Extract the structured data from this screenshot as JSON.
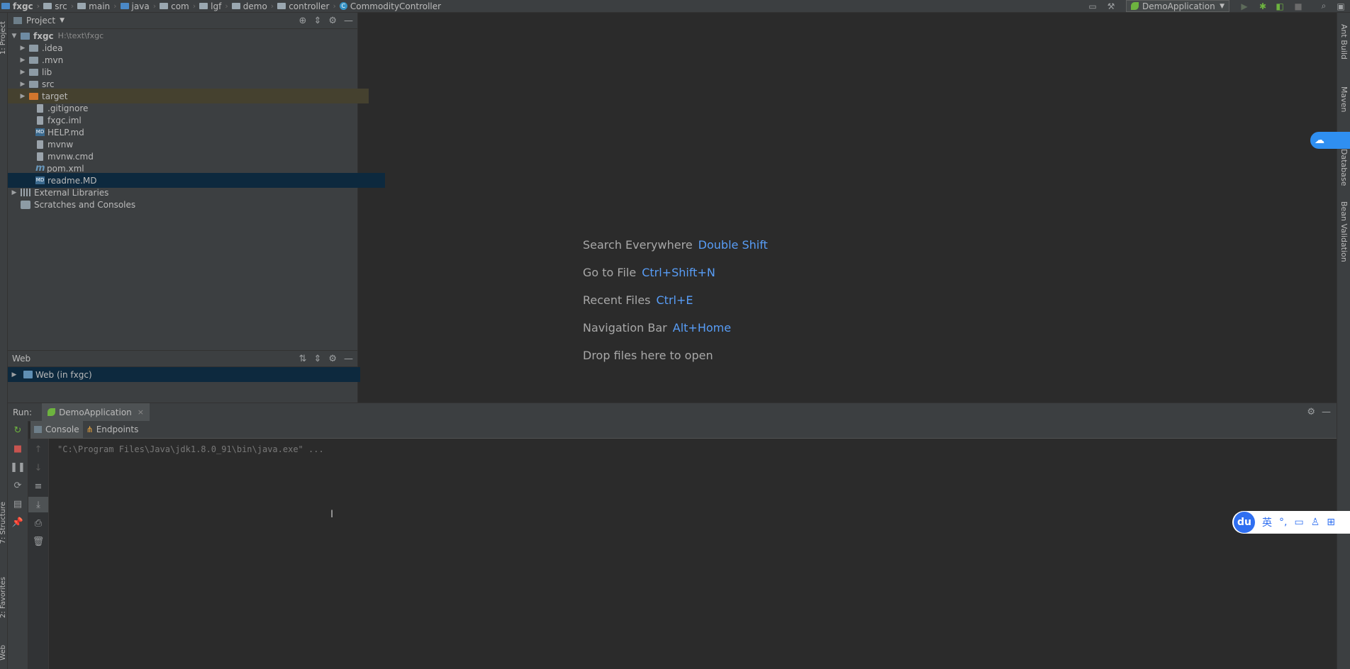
{
  "navbar": {
    "crumbs": [
      "fxgc",
      "src",
      "main",
      "java",
      "com",
      "lgf",
      "demo",
      "controller",
      "CommodityController"
    ],
    "run_config": "DemoApplication"
  },
  "left_strip": {
    "project_tab": "1: Project",
    "structure_tab": "7: Structure",
    "favorites_tab": "2: Favorites",
    "web_tab": "Web"
  },
  "right_strip": {
    "ant_build": "Ant Build",
    "maven": "Maven",
    "database": "Database",
    "bean_validation": "Bean Validation"
  },
  "project_panel": {
    "title": "Project",
    "root": {
      "name": "fxgc",
      "path": "H:\\text\\fxgc"
    },
    "items": [
      {
        "name": ".idea",
        "kind": "folder"
      },
      {
        "name": ".mvn",
        "kind": "folder"
      },
      {
        "name": "lib",
        "kind": "folder"
      },
      {
        "name": "src",
        "kind": "folder"
      },
      {
        "name": "target",
        "kind": "folder-excluded"
      },
      {
        "name": ".gitignore",
        "kind": "file"
      },
      {
        "name": "fxgc.iml",
        "kind": "file"
      },
      {
        "name": "HELP.md",
        "kind": "markdown"
      },
      {
        "name": "mvnw",
        "kind": "file"
      },
      {
        "name": "mvnw.cmd",
        "kind": "file"
      },
      {
        "name": "pom.xml",
        "kind": "maven"
      },
      {
        "name": "readme.MD",
        "kind": "markdown"
      }
    ],
    "external_libraries": "External Libraries",
    "scratches": "Scratches and Consoles"
  },
  "web_panel": {
    "title": "Web",
    "item": "Web (in fxgc)"
  },
  "editor_hints": [
    {
      "label": "Search Everywhere",
      "key": "Double Shift"
    },
    {
      "label": "Go to File",
      "key": "Ctrl+Shift+N"
    },
    {
      "label": "Recent Files",
      "key": "Ctrl+E"
    },
    {
      "label": "Navigation Bar",
      "key": "Alt+Home"
    },
    {
      "label": "Drop files here to open",
      "key": ""
    }
  ],
  "run_window": {
    "label": "Run:",
    "tab": "DemoApplication",
    "console_tab": "Console",
    "endpoints_tab": "Endpoints",
    "console_output": "\"C:\\Program Files\\Java\\jdk1.8.0_91\\bin\\java.exe\" ..."
  },
  "ime": {
    "logo": "du",
    "lang": "英"
  },
  "colors": {
    "background": "#2b2b2b",
    "panel": "#3c3f41",
    "selection": "#0d293e",
    "excluded_row": "#45412f",
    "shortcut_blue": "#589df6",
    "spring_green": "#6db33f"
  }
}
